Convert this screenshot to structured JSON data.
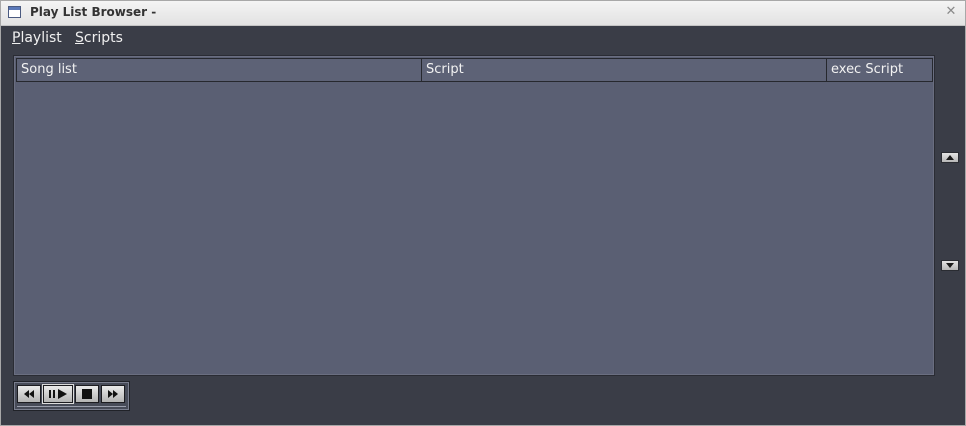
{
  "window": {
    "title": "Play List Browser -",
    "close_glyph": "✕"
  },
  "menu": {
    "items": [
      {
        "mnemonic": "P",
        "rest": "laylist"
      },
      {
        "mnemonic": "S",
        "rest": "cripts"
      }
    ]
  },
  "table": {
    "columns": [
      "Song list",
      "Script",
      "exec Script"
    ],
    "rows": []
  },
  "transport": {
    "buttons": [
      "rewind-icon",
      "play-pause-icon",
      "stop-icon",
      "fast-forward-icon"
    ]
  },
  "colors": {
    "window_bg": "#3a3d47",
    "list_bg": "#5a5f73",
    "text": "#f0f0f0"
  }
}
